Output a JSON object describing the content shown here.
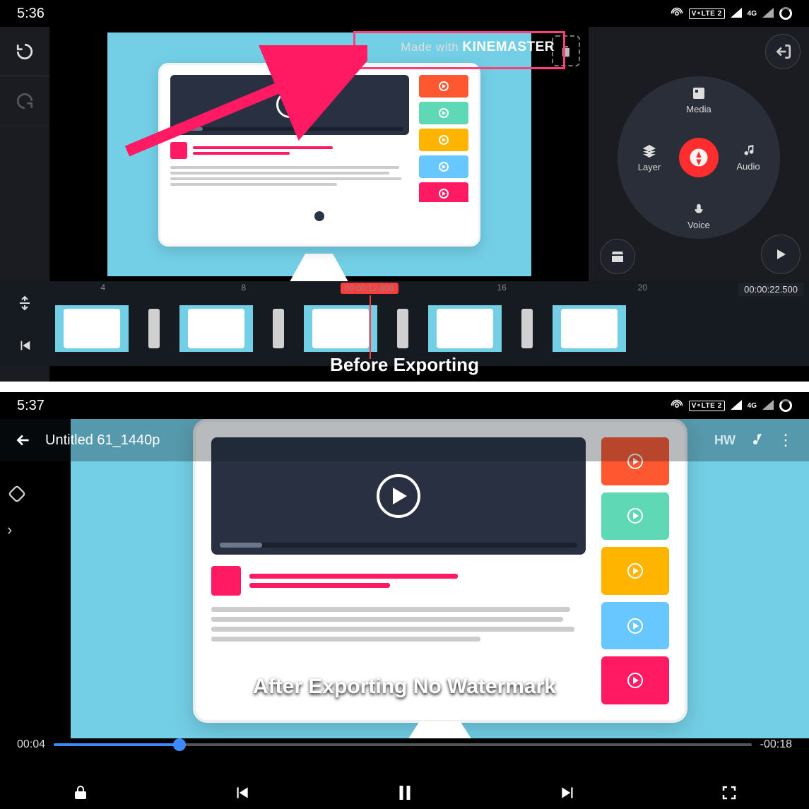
{
  "top": {
    "status_time": "5:36",
    "volte": "V∘LTE 2",
    "fg": "4G",
    "watermark_prefix": "Made with ",
    "watermark_brand": "KINEMASTER",
    "wheel": {
      "media": "Media",
      "layer": "Layer",
      "audio": "Audio",
      "voice": "Voice"
    },
    "timecode": "00:00:12.808",
    "duration": "00:00:22.500",
    "ruler": {
      "r4": "4",
      "r8": "8",
      "r16": "16",
      "r20": "20"
    },
    "caption": "Before Exporting"
  },
  "bot": {
    "status_time": "5:37",
    "volte": "V∘LTE 2",
    "fg": "4G",
    "title": "Untitled 61_1440p",
    "hw": "HW",
    "elapsed": "00:04",
    "remain": "-00:18",
    "caption": "After Exporting No Watermark"
  }
}
